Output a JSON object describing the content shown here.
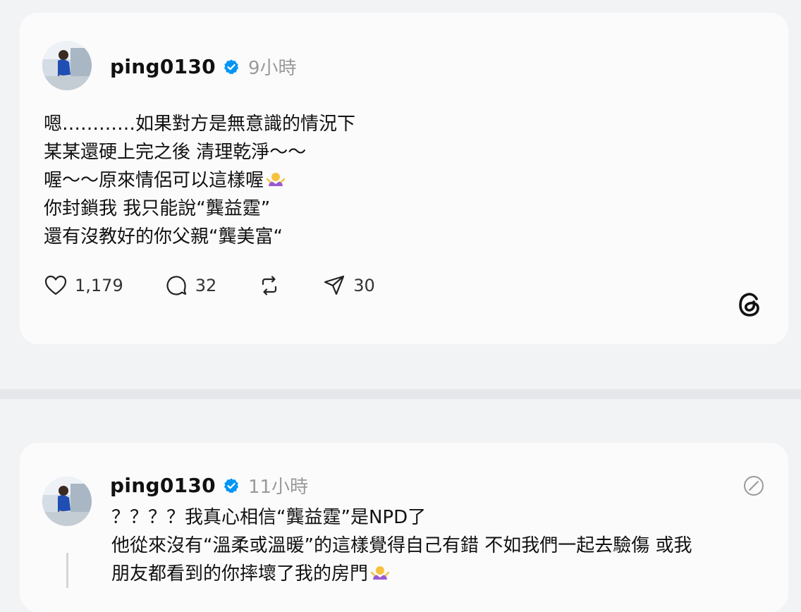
{
  "post1": {
    "username": "ping0130",
    "time": "9小時",
    "lines": [
      "嗯…………如果對方是無意識的情況下",
      "某某還硬上完之後 清理乾淨～～",
      "喔～～原來情侶可以這樣喔",
      "你封鎖我 我只能說“龔益霆”",
      "還有沒教好的你父親“龔美富“"
    ],
    "likes": "1,179",
    "comments": "32",
    "shares": "30"
  },
  "post2": {
    "username": "ping0130",
    "time": "11小時",
    "lines": [
      "？？？？我真心相信“龔益霆”是NPD了",
      "他從來沒有“溫柔或溫暖”的這樣覺得自己有錯 不如我們一起去驗傷 或我",
      "朋友都看到的你摔壞了我的房門"
    ]
  },
  "icons": {
    "verified": "verified-badge-icon",
    "like": "heart-icon",
    "comment": "comment-bubble-icon",
    "repost": "repost-icon",
    "share": "send-icon",
    "brand": "threads-logo-icon",
    "emoji": "shrug-emoji-icon"
  },
  "colors": {
    "verified": "#0095f6",
    "muted": "#9a9a9a",
    "card": "#fbfbfc",
    "background": "#f2f3f5"
  }
}
